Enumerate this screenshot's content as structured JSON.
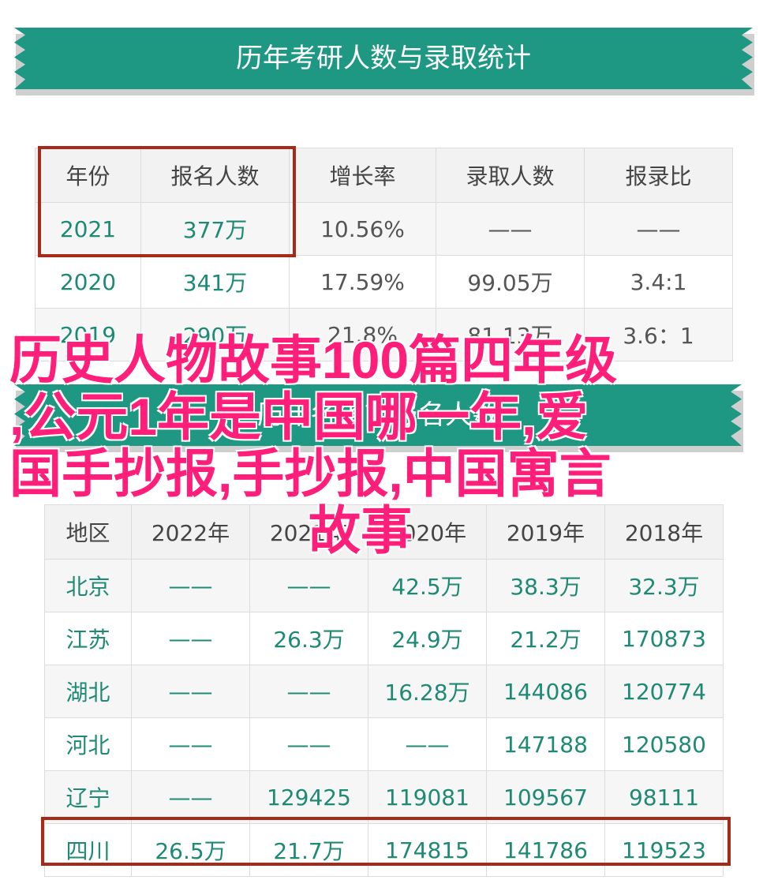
{
  "table1": {
    "title": "历年考研人数与录取统计",
    "headers": [
      "年份",
      "报名人数",
      "增长率",
      "录取人数",
      "报录比"
    ],
    "rows": [
      [
        "2021",
        "377万",
        "10.56%",
        "——",
        "——"
      ],
      [
        "2020",
        "341万",
        "17.59%",
        "99.05万",
        "3.4:1"
      ],
      [
        "2019",
        "290万",
        "21.8%",
        "81.13万",
        "3.6：1"
      ]
    ]
  },
  "table2": {
    "title": "历年各省市报名人数",
    "headers": [
      "地区",
      "2022年",
      "2021年",
      "2020年",
      "2019年",
      "2018年"
    ],
    "rows": [
      [
        "北京",
        "——",
        "——",
        "42.5万",
        "38.3万",
        "32.3万"
      ],
      [
        "江苏",
        "——",
        "26.3万",
        "24.9万",
        "21.2万",
        "170873"
      ],
      [
        "湖北",
        "——",
        "——",
        "16.28万",
        "144086",
        "120774"
      ],
      [
        "河北",
        "——",
        "——",
        "——",
        "147188",
        "120580"
      ],
      [
        "辽宁",
        "——",
        "129425",
        "119081",
        "109567",
        "98111"
      ],
      [
        "四川",
        "26.5万",
        "21.7万",
        "174815",
        "141786",
        "119523"
      ]
    ]
  },
  "overlay_title": {
    "line1": "历史人物故事100篇四年级",
    "line2": ",公元1年是中国哪一年,爱",
    "line3": "国手抄报,手抄报,中国寓言",
    "line4": "故事"
  },
  "colors": {
    "banner": "#1e9883",
    "highlight": "#a52a1a",
    "overlay_text": "#ff1f7a",
    "teal_text": "#1e8a74"
  }
}
